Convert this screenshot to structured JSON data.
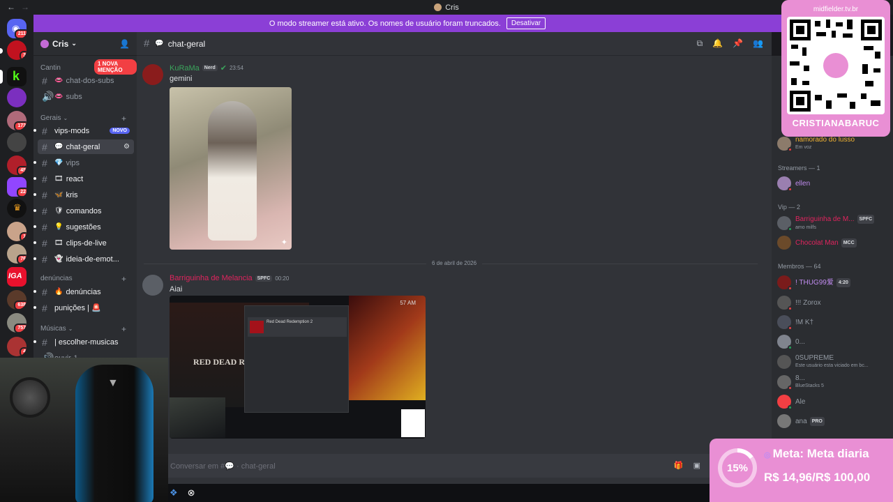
{
  "titlebar": {
    "title": "Cris"
  },
  "banner": {
    "text": "O modo streamer está ativo. Os nomes de usuário foram truncados.",
    "button": "Desativar"
  },
  "rail": {
    "badges": [
      "211",
      "3",
      "173",
      "45",
      "22",
      "1",
      "76",
      "638",
      "757",
      "4"
    ]
  },
  "sidebar": {
    "server_name": "Cris",
    "mention_pill": "1 NOVA MENÇÃO",
    "categories": {
      "cantinho": "Cantin",
      "gerais": "Gerais",
      "denuncias": "denúncias",
      "musicas": "Músicas"
    },
    "channels": [
      {
        "emoji": "👄",
        "name": "chat-dos-subs"
      },
      {
        "emoji": "👄",
        "name": "subs"
      },
      {
        "emoji": "",
        "name": "vips-mods",
        "badge": "NOVO"
      },
      {
        "emoji": "💬",
        "name": "chat-geral"
      },
      {
        "emoji": "💎",
        "name": "vips"
      },
      {
        "emoji": "🎞",
        "name": "react"
      },
      {
        "emoji": "🦋",
        "name": "kris"
      },
      {
        "emoji": "🛡",
        "name": "comandos"
      },
      {
        "emoji": "💡",
        "name": "sugestões"
      },
      {
        "emoji": "🎞",
        "name": "clips-de-live"
      },
      {
        "emoji": "👻",
        "name": "ideia-de-emot..."
      },
      {
        "emoji": "🔥",
        "name": "denúncias"
      },
      {
        "emoji": "",
        "name": "punições | 🚨"
      },
      {
        "emoji": "♪",
        "name": "| escolher-musicas"
      },
      {
        "emoji": "",
        "name": "ouvir-1"
      }
    ]
  },
  "chat": {
    "channel": "chat-geral",
    "messages": [
      {
        "author": "KuRaMa",
        "tag": "Nerd",
        "time": "23:54",
        "text": "gemini",
        "author_color": "#3ba55c"
      },
      {
        "author": "Barriguinha de Melancia",
        "tag": "SPFC",
        "time": "00:20",
        "text": "Aiai",
        "author_color": "#e0245e"
      }
    ],
    "date_divider": "6 de abril de 2026",
    "embed": {
      "app_title": "Red Dead Redemption 2",
      "game_text": "RED DEAD REDEMPTION II",
      "clock": "57 AM"
    },
    "composer_placeholder": "Conversar em #💬 · chat-geral"
  },
  "members": {
    "top": [
      {
        "name": "namorado do lusso",
        "sub": "Em voz"
      }
    ],
    "groups": [
      {
        "title": "Streamers — 1",
        "members": [
          {
            "name": "ellen",
            "color": "#c18cf0"
          }
        ]
      },
      {
        "title": "Vip — 2",
        "members": [
          {
            "name": "Barriguinha de M...",
            "tag": "SPFC",
            "sub": "amo milfs",
            "color": "#e0245e"
          },
          {
            "name": "Chocolat Man",
            "tag": "MCC",
            "color": "#e0245e"
          }
        ]
      },
      {
        "title": "Membros — 64",
        "members": [
          {
            "name": "! THUG99爱",
            "tag": "4:20",
            "color": "#c18cf0"
          },
          {
            "name": "!!! Zorox",
            "color": "#949ba4"
          },
          {
            "name": "!M K†",
            "color": "#949ba4"
          },
          {
            "name": "0...",
            "color": "#949ba4"
          },
          {
            "name": "0SUPREME",
            "sub": "Este usuário esta viciado em bc...",
            "color": "#949ba4"
          },
          {
            "name": "8...",
            "sub": "BlueStacks 5",
            "color": "#949ba4"
          },
          {
            "name": "Ale",
            "color": "#949ba4"
          },
          {
            "name": "ana",
            "tag": "PRO",
            "color": "#949ba4"
          }
        ]
      }
    ]
  },
  "overlay": {
    "qr_site": "midfielder.tv.br",
    "qr_user": "CRISTIANABARUC",
    "goal_title": "Meta: Meta diaria",
    "goal_value": "R$ 14,96/R$ 100,00",
    "goal_percent_label": "15%",
    "goal_progress": 0.15
  },
  "colors": {
    "banner": "#8b3fd6",
    "overlay_pink": "#e98fd4",
    "mention_red": "#f23f43"
  }
}
